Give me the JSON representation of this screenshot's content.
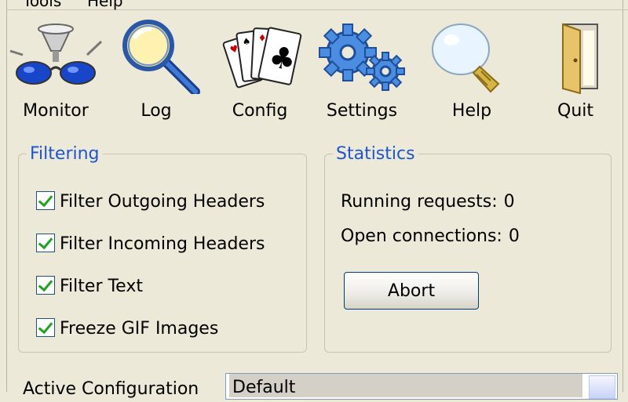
{
  "menubar": {
    "items": [
      "Tools",
      "Help"
    ]
  },
  "toolbar": {
    "items": [
      {
        "label": "Monitor",
        "icon": "glasses-icon"
      },
      {
        "label": "Log",
        "icon": "magnifier-icon"
      },
      {
        "label": "Config",
        "icon": "cards-icon"
      },
      {
        "label": "Settings",
        "icon": "gears-icon"
      },
      {
        "label": "Help",
        "icon": "lightbulb-icon"
      },
      {
        "label": "Quit",
        "icon": "door-icon"
      }
    ]
  },
  "filtering": {
    "legend": "Filtering",
    "options": [
      {
        "label": "Filter Outgoing Headers",
        "checked": true
      },
      {
        "label": "Filter Incoming Headers",
        "checked": true
      },
      {
        "label": "Filter Text",
        "checked": true
      },
      {
        "label": "Freeze GIF Images",
        "checked": true
      }
    ]
  },
  "statistics": {
    "legend": "Statistics",
    "running_label": "Running requests:",
    "running_value": "0",
    "open_label": "Open connections:",
    "open_value": "0",
    "abort_label": "Abort"
  },
  "footer": {
    "active_config_label": "Active Configuration",
    "active_config_value": "Default"
  },
  "colors": {
    "legend": "#1f55cc",
    "check": "#21a121",
    "background": "#ece9d8"
  }
}
